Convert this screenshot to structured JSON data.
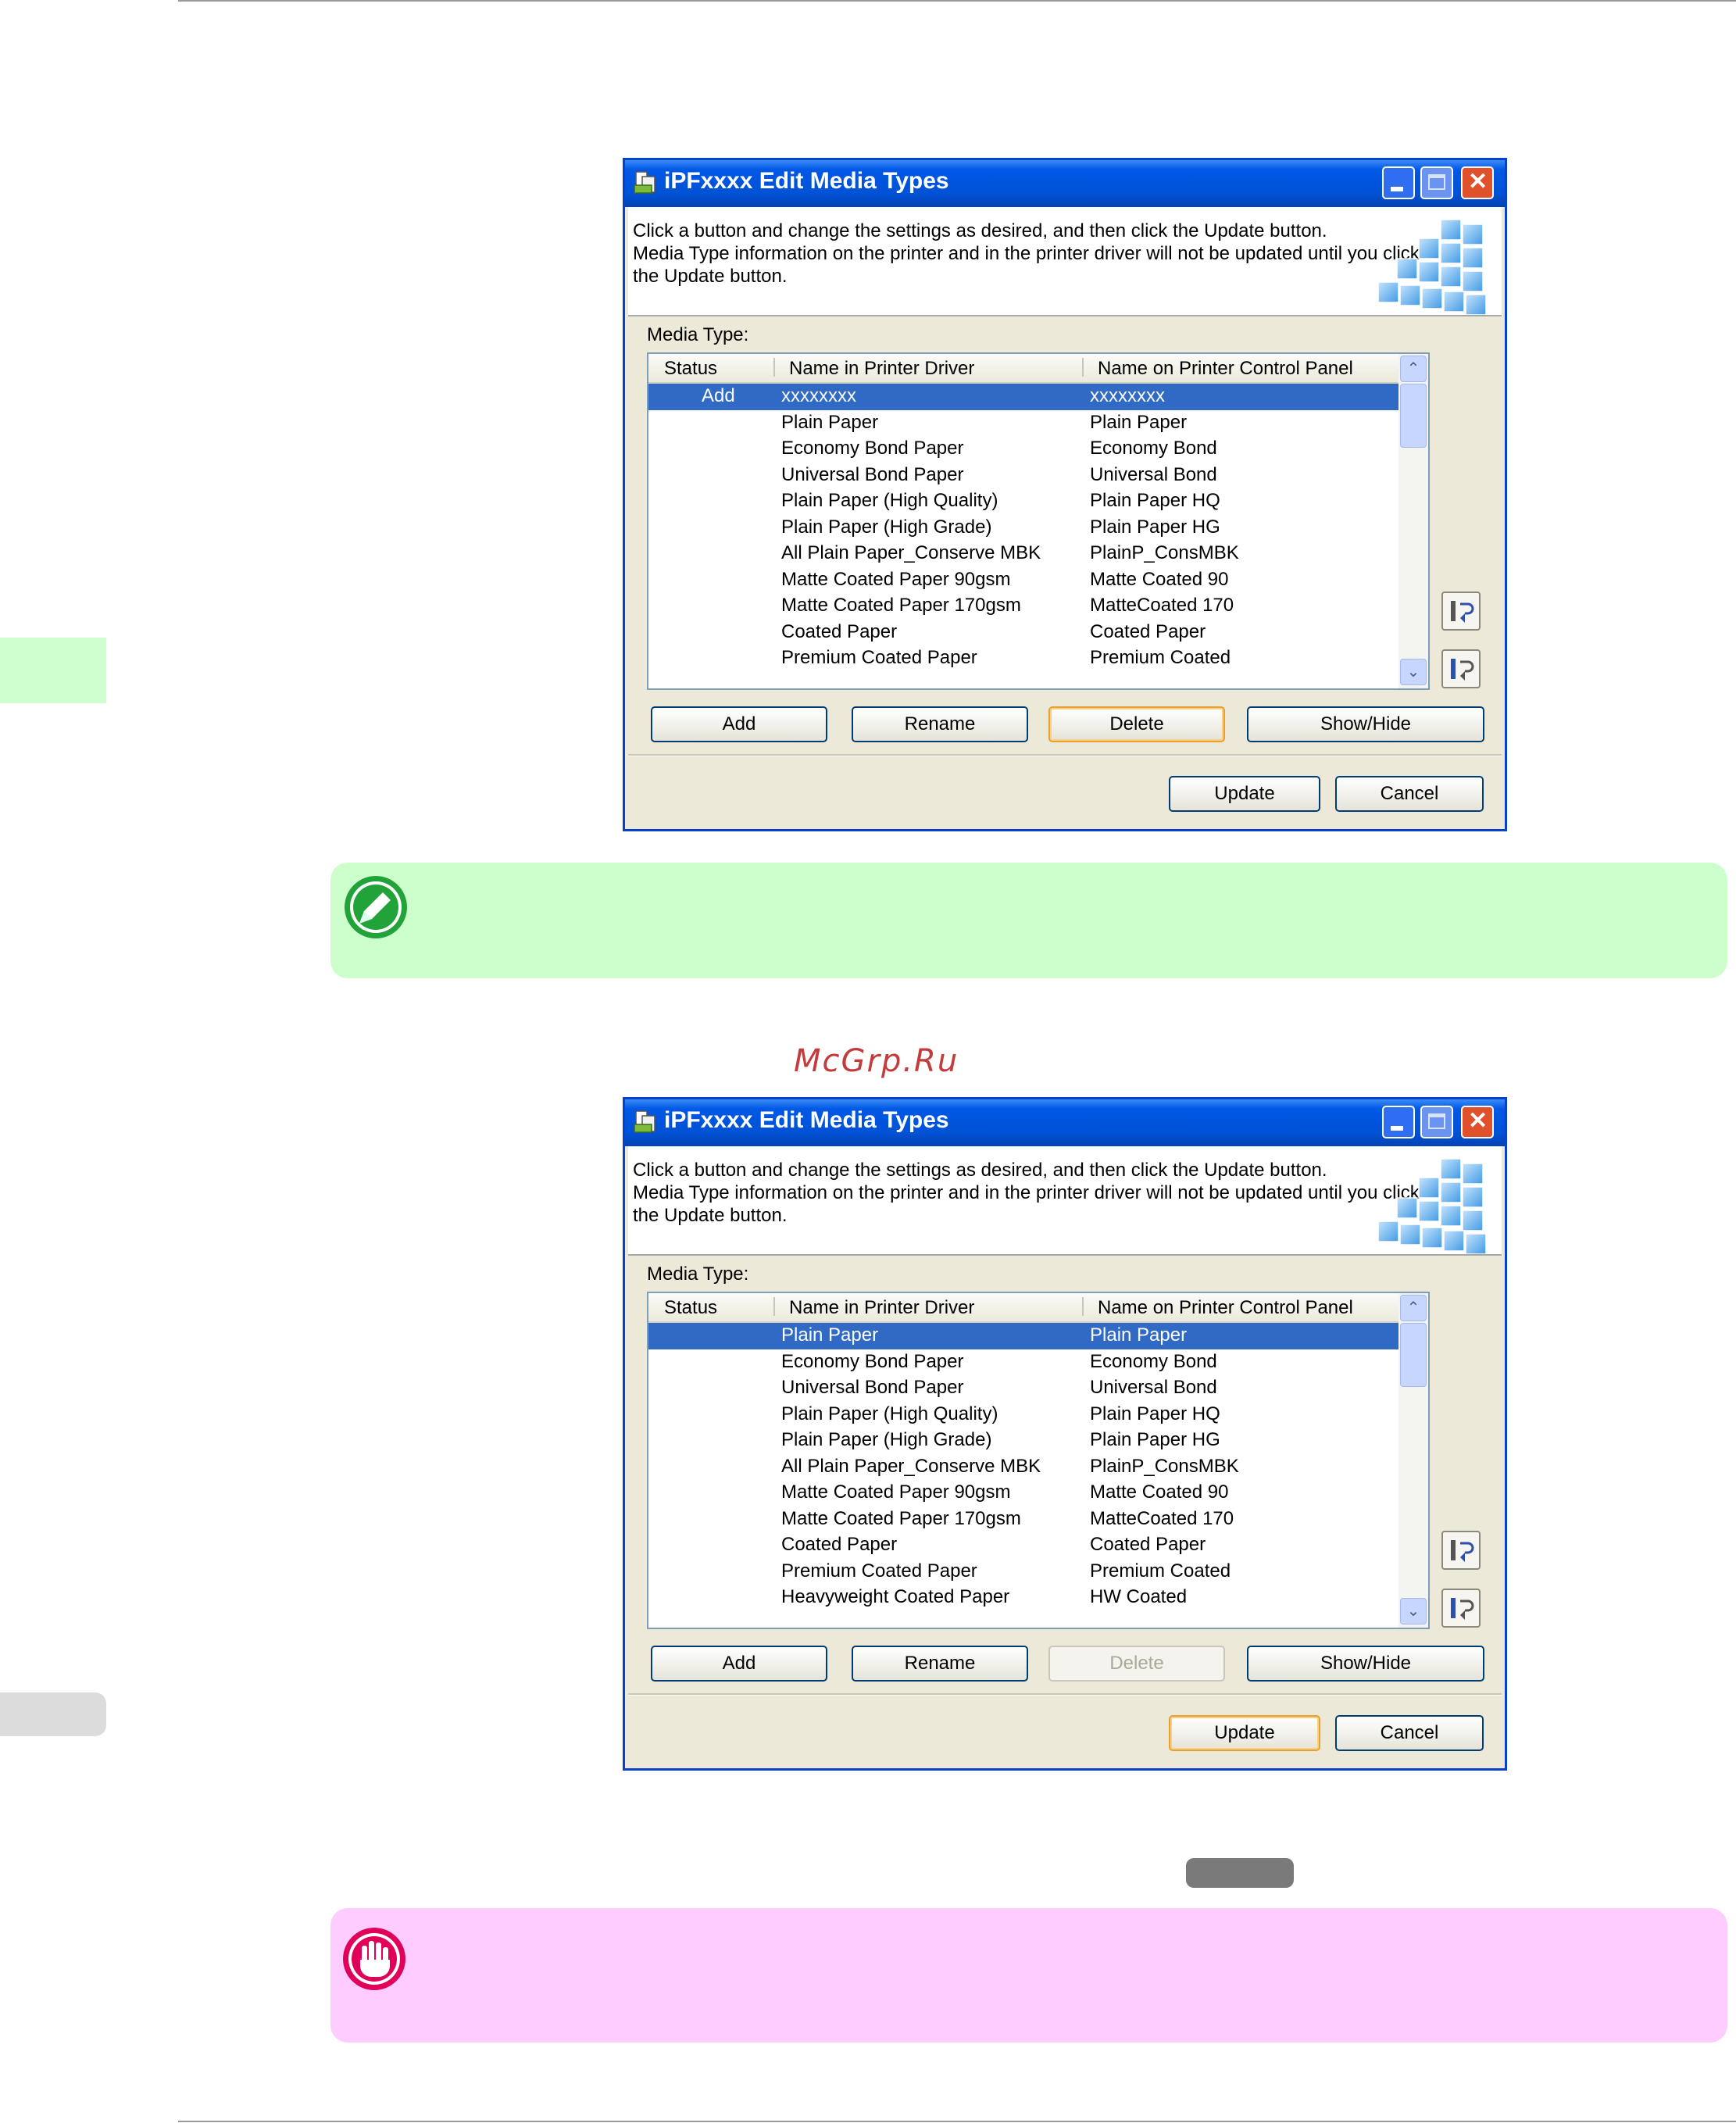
{
  "watermark": "McGrp.Ru",
  "dialog1": {
    "title": "iPFxxxx Edit Media Types",
    "instructions": [
      "Click a button and change the settings as desired, and then click the Update button.",
      "Media Type information on the printer and in the printer driver will not be updated until you click",
      "the Update button."
    ],
    "media_type_label": "Media Type:",
    "columns": [
      "Status",
      "Name in Printer Driver",
      "Name on Printer Control Panel"
    ],
    "rows": [
      {
        "status": "Add",
        "name": "xxxxxxxx",
        "panel": "xxxxxxxx"
      },
      {
        "status": "",
        "name": "Plain Paper",
        "panel": "Plain Paper"
      },
      {
        "status": "",
        "name": "Economy Bond Paper",
        "panel": "Economy Bond"
      },
      {
        "status": "",
        "name": "Universal Bond Paper",
        "panel": "Universal Bond"
      },
      {
        "status": "",
        "name": "Plain Paper (High Quality)",
        "panel": "Plain Paper HQ"
      },
      {
        "status": "",
        "name": "Plain Paper (High Grade)",
        "panel": "Plain Paper HG"
      },
      {
        "status": "",
        "name": "All Plain Paper_Conserve MBK",
        "panel": "PlainP_ConsMBK"
      },
      {
        "status": "",
        "name": "Matte Coated Paper 90gsm",
        "panel": "Matte Coated 90"
      },
      {
        "status": "",
        "name": "Matte Coated Paper 170gsm",
        "panel": "MatteCoated 170"
      },
      {
        "status": "",
        "name": "Coated Paper",
        "panel": "Coated Paper"
      },
      {
        "status": "",
        "name": "Premium Coated Paper",
        "panel": "Premium Coated"
      }
    ],
    "buttons": {
      "add": "Add",
      "rename": "Rename",
      "delete": "Delete",
      "show_hide": "Show/Hide",
      "update": "Update",
      "cancel": "Cancel"
    }
  },
  "dialog2": {
    "title": "iPFxxxx Edit Media Types",
    "instructions": [
      "Click a button and change the settings as desired, and then click the Update button.",
      "Media Type information on the printer and in the printer driver will not be updated until you click",
      "the Update button."
    ],
    "media_type_label": "Media Type:",
    "columns": [
      "Status",
      "Name in Printer Driver",
      "Name on Printer Control Panel"
    ],
    "rows": [
      {
        "status": "",
        "name": "Plain Paper",
        "panel": "Plain Paper"
      },
      {
        "status": "",
        "name": "Economy Bond Paper",
        "panel": "Economy Bond"
      },
      {
        "status": "",
        "name": "Universal Bond Paper",
        "panel": "Universal Bond"
      },
      {
        "status": "",
        "name": "Plain Paper (High Quality)",
        "panel": "Plain Paper HQ"
      },
      {
        "status": "",
        "name": "Plain Paper (High Grade)",
        "panel": "Plain Paper HG"
      },
      {
        "status": "",
        "name": "All Plain Paper_Conserve MBK",
        "panel": "PlainP_ConsMBK"
      },
      {
        "status": "",
        "name": "Matte Coated Paper 90gsm",
        "panel": "Matte Coated 90"
      },
      {
        "status": "",
        "name": "Matte Coated Paper 170gsm",
        "panel": "MatteCoated 170"
      },
      {
        "status": "",
        "name": "Coated Paper",
        "panel": "Coated Paper"
      },
      {
        "status": "",
        "name": "Premium Coated Paper",
        "panel": "Premium Coated"
      },
      {
        "status": "",
        "name": "Heavyweight Coated Paper",
        "panel": "HW Coated"
      }
    ],
    "buttons": {
      "add": "Add",
      "rename": "Rename",
      "delete": "Delete",
      "show_hide": "Show/Hide",
      "update": "Update",
      "cancel": "Cancel"
    }
  },
  "colors": {
    "titlebar": "#0058e6",
    "selection": "#316ac5",
    "note_bg": "#ccffcc",
    "important_bg": "#ffccff",
    "watermark": "#c43b3b"
  },
  "icons": {
    "note": "pencil-note-icon",
    "important": "hand-stop-icon",
    "title": "printer-app-icon",
    "move_up": "move-up-icon",
    "move_down": "move-down-icon"
  }
}
